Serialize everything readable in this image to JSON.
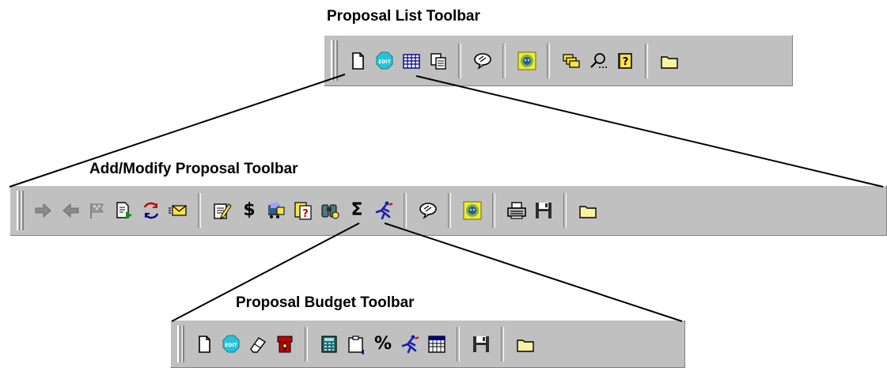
{
  "captions": {
    "proposal_list": "Proposal List Toolbar",
    "add_modify": "Add/Modify Proposal Toolbar",
    "proposal_budget": "Proposal Budget Toolbar"
  },
  "toolbars": {
    "proposal_list": {
      "groups": [
        [
          "new-document-icon",
          "edit-icon",
          "grid-icon",
          "copy-icon"
        ],
        [
          "speech-bubble-icon"
        ],
        [
          "lion-icon"
        ],
        [
          "layers-icon",
          "search-icon",
          "help-book-icon"
        ],
        [
          "folder-icon"
        ]
      ]
    },
    "add_modify": {
      "groups": [
        [
          "arrow-right-icon",
          "arrow-left-icon",
          "flag-icon",
          "document-go-icon",
          "recycle-icon",
          "envelope-icon"
        ],
        [
          "notepad-pencil-icon",
          "dollar-icon",
          "cart-icon",
          "question-doc-icon",
          "binoculars-icon",
          "sigma-icon",
          "running-man-icon"
        ],
        [
          "speech-bubble-icon"
        ],
        [
          "lion-icon"
        ],
        [
          "printer-icon",
          "save-icon"
        ],
        [
          "folder-icon"
        ]
      ]
    },
    "proposal_budget": {
      "groups": [
        [
          "new-document-icon",
          "edit-icon",
          "eraser-icon",
          "lock-icon"
        ],
        [
          "calculator-icon",
          "clipboard-icon",
          "percent-icon",
          "running-man-icon",
          "calendar-icon"
        ],
        [
          "save-icon"
        ],
        [
          "folder-icon"
        ]
      ]
    }
  },
  "glyphs": {
    "dollar-icon": "$",
    "percent-icon": "%",
    "sigma-icon": "Σ"
  },
  "colors": {
    "toolbar_bg": "#c0c0c0",
    "edit_icon": "#26c4d9",
    "lion_bg": "#f0ea3a",
    "running_man": "#1c1cb0",
    "folder": "#fbf2a0"
  }
}
